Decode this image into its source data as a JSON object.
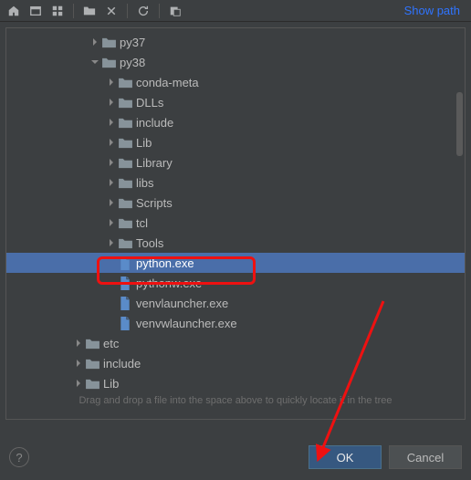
{
  "toolbar": {
    "show_path_label": "Show path"
  },
  "tree": [
    {
      "indent": 5,
      "chev": "right",
      "kind": "folder",
      "label": "py37",
      "selected": false
    },
    {
      "indent": 5,
      "chev": "down",
      "kind": "folder",
      "label": "py38",
      "selected": false
    },
    {
      "indent": 6,
      "chev": "right",
      "kind": "folder",
      "label": "conda-meta",
      "selected": false
    },
    {
      "indent": 6,
      "chev": "right",
      "kind": "folder",
      "label": "DLLs",
      "selected": false
    },
    {
      "indent": 6,
      "chev": "right",
      "kind": "folder",
      "label": "include",
      "selected": false
    },
    {
      "indent": 6,
      "chev": "right",
      "kind": "folder",
      "label": "Lib",
      "selected": false
    },
    {
      "indent": 6,
      "chev": "right",
      "kind": "folder",
      "label": "Library",
      "selected": false
    },
    {
      "indent": 6,
      "chev": "right",
      "kind": "folder",
      "label": "libs",
      "selected": false
    },
    {
      "indent": 6,
      "chev": "right",
      "kind": "folder",
      "label": "Scripts",
      "selected": false
    },
    {
      "indent": 6,
      "chev": "right",
      "kind": "folder",
      "label": "tcl",
      "selected": false
    },
    {
      "indent": 6,
      "chev": "right",
      "kind": "folder",
      "label": "Tools",
      "selected": false
    },
    {
      "indent": 6,
      "chev": "none",
      "kind": "file",
      "label": "python.exe",
      "selected": true
    },
    {
      "indent": 6,
      "chev": "none",
      "kind": "file",
      "label": "pythonw.exe",
      "selected": false
    },
    {
      "indent": 6,
      "chev": "none",
      "kind": "file",
      "label": "venvlauncher.exe",
      "selected": false
    },
    {
      "indent": 6,
      "chev": "none",
      "kind": "file",
      "label": "venvwlauncher.exe",
      "selected": false
    },
    {
      "indent": 4,
      "chev": "right",
      "kind": "folder",
      "label": "etc",
      "selected": false
    },
    {
      "indent": 4,
      "chev": "right",
      "kind": "folder",
      "label": "include",
      "selected": false
    },
    {
      "indent": 4,
      "chev": "right",
      "kind": "folder",
      "label": "Lib",
      "selected": false
    }
  ],
  "hint": "Drag and drop a file into the space above to quickly locate it in the tree",
  "buttons": {
    "ok": "OK",
    "cancel": "Cancel"
  },
  "help": "?"
}
